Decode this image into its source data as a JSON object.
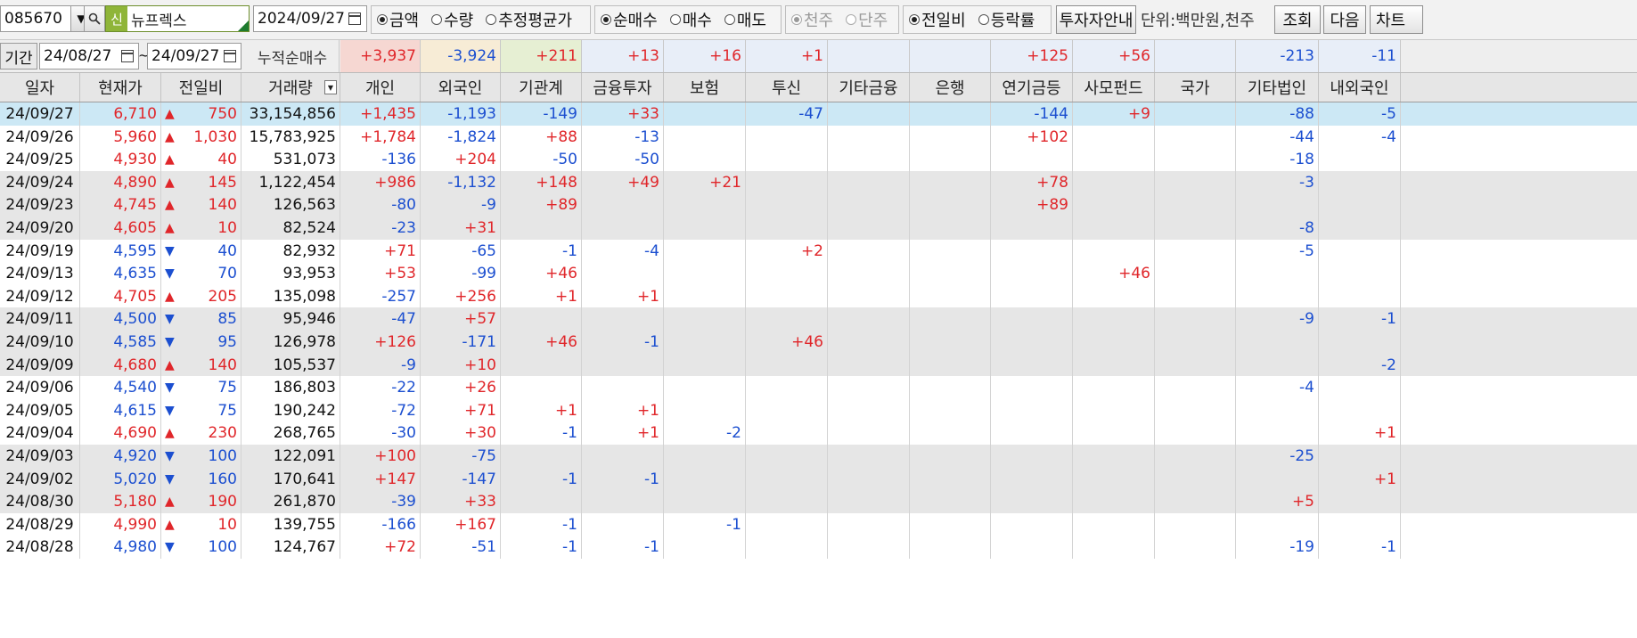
{
  "toolbar": {
    "stock_code": "085670",
    "new_badge": "신",
    "stock_name": "뉴프렉스",
    "date": "2024/09/27",
    "group1": [
      "금액",
      "수량",
      "추정평균가"
    ],
    "group1_selected": 0,
    "group2": [
      "순매수",
      "매수",
      "매도"
    ],
    "group2_selected": 0,
    "group3": [
      "천주",
      "단주"
    ],
    "group3_selected": 0,
    "group4": [
      "전일비",
      "등락률"
    ],
    "group4_selected": 0,
    "investor_guide": "투자자안내",
    "unit_text": "단위:백만원,천주",
    "query": "조회",
    "next": "다음",
    "chart": "차트"
  },
  "period": {
    "label": "기간",
    "from": "24/08/27",
    "tilde": "~",
    "to": "24/09/27",
    "cum_label": "누적순매수",
    "cum_values": [
      "+3,937",
      "-3,924",
      "+211",
      "+13",
      "+16",
      "+1",
      "",
      "",
      "+125",
      "+56",
      "",
      "-213",
      "-11"
    ]
  },
  "headers": [
    "일자",
    "현재가",
    "전일비",
    "거래량",
    "개인",
    "외국인",
    "기관계",
    "금융투자",
    "보험",
    "투신",
    "기타금융",
    "은행",
    "연기금등",
    "사모펀드",
    "국가",
    "기타법인",
    "내외국인"
  ],
  "rows": [
    {
      "date": "24/09/27",
      "price": "6,710",
      "dir": "up",
      "chg": "750",
      "vol": "33,154,856",
      "v": [
        "+1,435",
        "-1,193",
        "-149",
        "+33",
        "",
        "-47",
        "",
        "",
        "-144",
        "+9",
        "",
        "-88",
        "-5"
      ]
    },
    {
      "date": "24/09/26",
      "price": "5,960",
      "dir": "up",
      "chg": "1,030",
      "vol": "15,783,925",
      "v": [
        "+1,784",
        "-1,824",
        "+88",
        "-13",
        "",
        "",
        "",
        "",
        "+102",
        "",
        "",
        "-44",
        "-4"
      ]
    },
    {
      "date": "24/09/25",
      "price": "4,930",
      "dir": "up",
      "chg": "40",
      "vol": "531,073",
      "v": [
        "-136",
        "+204",
        "-50",
        "-50",
        "",
        "",
        "",
        "",
        "",
        "",
        "",
        "-18",
        ""
      ]
    },
    {
      "date": "24/09/24",
      "price": "4,890",
      "dir": "up",
      "chg": "145",
      "vol": "1,122,454",
      "v": [
        "+986",
        "-1,132",
        "+148",
        "+49",
        "+21",
        "",
        "",
        "",
        "+78",
        "",
        "",
        "-3",
        ""
      ]
    },
    {
      "date": "24/09/23",
      "price": "4,745",
      "dir": "up",
      "chg": "140",
      "vol": "126,563",
      "v": [
        "-80",
        "-9",
        "+89",
        "",
        "",
        "",
        "",
        "",
        "+89",
        "",
        "",
        "",
        ""
      ]
    },
    {
      "date": "24/09/20",
      "price": "4,605",
      "dir": "up",
      "chg": "10",
      "vol": "82,524",
      "v": [
        "-23",
        "+31",
        "",
        "",
        "",
        "",
        "",
        "",
        "",
        "",
        "",
        "-8",
        ""
      ]
    },
    {
      "date": "24/09/19",
      "price": "4,595",
      "dir": "down",
      "chg": "40",
      "vol": "82,932",
      "v": [
        "+71",
        "-65",
        "-1",
        "-4",
        "",
        "+2",
        "",
        "",
        "",
        "",
        "",
        "-5",
        ""
      ]
    },
    {
      "date": "24/09/13",
      "price": "4,635",
      "dir": "down",
      "chg": "70",
      "vol": "93,953",
      "v": [
        "+53",
        "-99",
        "+46",
        "",
        "",
        "",
        "",
        "",
        "",
        "+46",
        "",
        "",
        ""
      ]
    },
    {
      "date": "24/09/12",
      "price": "4,705",
      "dir": "up",
      "chg": "205",
      "vol": "135,098",
      "v": [
        "-257",
        "+256",
        "+1",
        "+1",
        "",
        "",
        "",
        "",
        "",
        "",
        "",
        "",
        ""
      ]
    },
    {
      "date": "24/09/11",
      "price": "4,500",
      "dir": "down",
      "chg": "85",
      "vol": "95,946",
      "v": [
        "-47",
        "+57",
        "",
        "",
        "",
        "",
        "",
        "",
        "",
        "",
        "",
        "-9",
        "-1"
      ]
    },
    {
      "date": "24/09/10",
      "price": "4,585",
      "dir": "down",
      "chg": "95",
      "vol": "126,978",
      "v": [
        "+126",
        "-171",
        "+46",
        "-1",
        "",
        "+46",
        "",
        "",
        "",
        "",
        "",
        "",
        ""
      ]
    },
    {
      "date": "24/09/09",
      "price": "4,680",
      "dir": "up",
      "chg": "140",
      "vol": "105,537",
      "v": [
        "-9",
        "+10",
        "",
        "",
        "",
        "",
        "",
        "",
        "",
        "",
        "",
        "",
        "-2"
      ]
    },
    {
      "date": "24/09/06",
      "price": "4,540",
      "dir": "down",
      "chg": "75",
      "vol": "186,803",
      "v": [
        "-22",
        "+26",
        "",
        "",
        "",
        "",
        "",
        "",
        "",
        "",
        "",
        "-4",
        ""
      ]
    },
    {
      "date": "24/09/05",
      "price": "4,615",
      "dir": "down",
      "chg": "75",
      "vol": "190,242",
      "v": [
        "-72",
        "+71",
        "+1",
        "+1",
        "",
        "",
        "",
        "",
        "",
        "",
        "",
        "",
        ""
      ]
    },
    {
      "date": "24/09/04",
      "price": "4,690",
      "dir": "up",
      "chg": "230",
      "vol": "268,765",
      "v": [
        "-30",
        "+30",
        "-1",
        "+1",
        "-2",
        "",
        "",
        "",
        "",
        "",
        "",
        "",
        "+1"
      ]
    },
    {
      "date": "24/09/03",
      "price": "4,920",
      "dir": "down",
      "chg": "100",
      "vol": "122,091",
      "v": [
        "+100",
        "-75",
        "",
        "",
        "",
        "",
        "",
        "",
        "",
        "",
        "",
        "-25",
        ""
      ]
    },
    {
      "date": "24/09/02",
      "price": "5,020",
      "dir": "down",
      "chg": "160",
      "vol": "170,641",
      "v": [
        "+147",
        "-147",
        "-1",
        "-1",
        "",
        "",
        "",
        "",
        "",
        "",
        "",
        "",
        "+1"
      ]
    },
    {
      "date": "24/08/30",
      "price": "5,180",
      "dir": "up",
      "chg": "190",
      "vol": "261,870",
      "v": [
        "-39",
        "+33",
        "",
        "",
        "",
        "",
        "",
        "",
        "",
        "",
        "",
        "+5",
        ""
      ]
    },
    {
      "date": "24/08/29",
      "price": "4,990",
      "dir": "up",
      "chg": "10",
      "vol": "139,755",
      "v": [
        "-166",
        "+167",
        "-1",
        "",
        "-1",
        "",
        "",
        "",
        "",
        "",
        "",
        "",
        ""
      ]
    },
    {
      "date": "24/08/28",
      "price": "4,980",
      "dir": "down",
      "chg": "100",
      "vol": "124,767",
      "v": [
        "+72",
        "-51",
        "-1",
        "-1",
        "",
        "",
        "",
        "",
        "",
        "",
        "",
        "-19",
        "-1"
      ]
    }
  ],
  "colors": {
    "up": "#e0262a",
    "down": "#1c4fd0",
    "selected_row": "#cce8f5",
    "shade_row": "#e6e6e6",
    "sum_individual": "#f6d7d2",
    "sum_foreign": "#f7ecd6",
    "sum_inst": "#e6efd3",
    "sum_other": "#e8eef8"
  }
}
